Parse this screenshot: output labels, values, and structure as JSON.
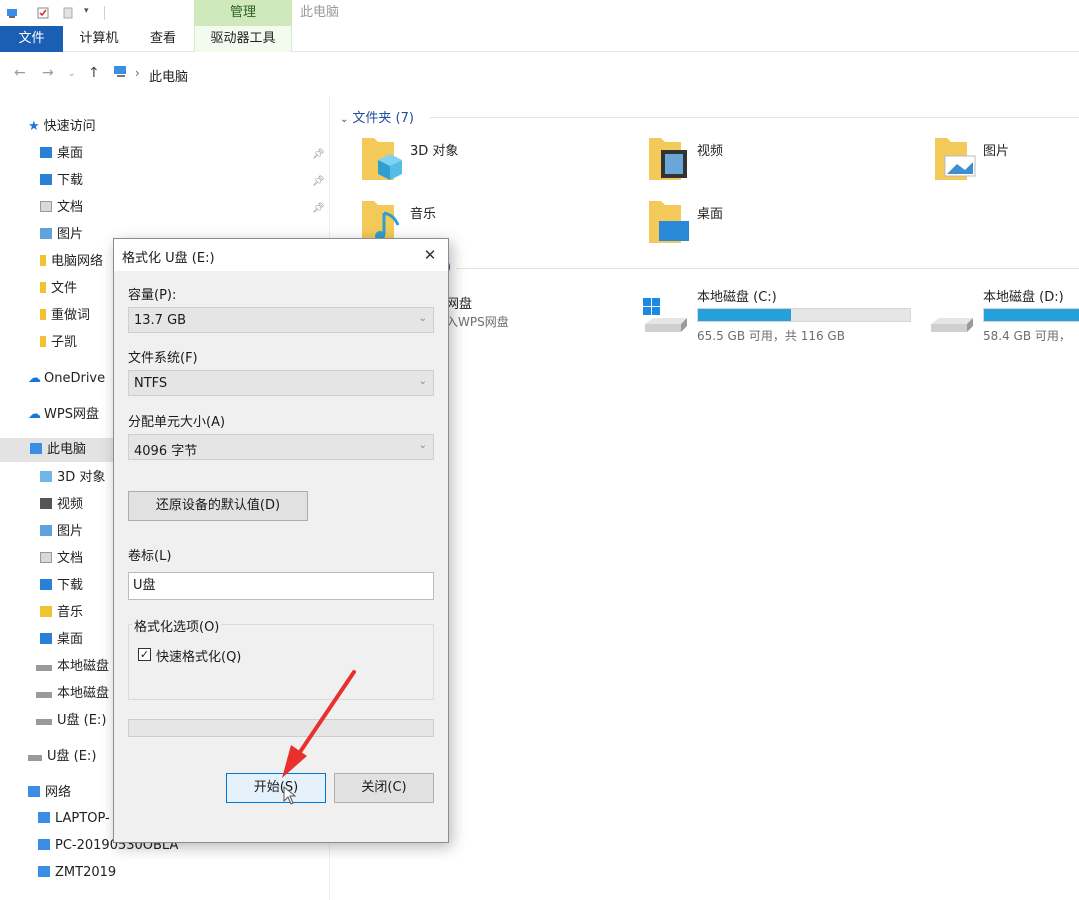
{
  "ribbon": {
    "context_tab": "管理",
    "window_title": "此电脑",
    "tabs": [
      "文件",
      "计算机",
      "查看",
      "驱动器工具"
    ]
  },
  "address": {
    "path": "此电脑"
  },
  "nav_pane": {
    "quick_access": "快速访问",
    "quick_items": [
      "桌面",
      "下载",
      "文档",
      "图片",
      "电脑网络",
      "文件",
      "重做词",
      "子凯"
    ],
    "onedrive": "OneDrive",
    "wps": "WPS网盘",
    "this_pc": "此电脑",
    "pc_items": [
      "3D 对象",
      "视频",
      "图片",
      "文档",
      "下载",
      "音乐",
      "桌面",
      "本地磁盘",
      "本地磁盘",
      "U盘 (E:)"
    ],
    "usb": "U盘 (E:)",
    "network": "网络",
    "network_items": [
      "LAPTOP-",
      "PC-20190530OBLA",
      "ZMT2019"
    ]
  },
  "content": {
    "folders_header": "文件夹 (7)",
    "folders": [
      "3D 对象",
      "视频",
      "图片",
      "音乐",
      "桌面"
    ],
    "devices_header_partial": ")",
    "wps_partial_name": "网盘",
    "wps_partial_info": "入WPS网盘",
    "drives": [
      {
        "name": "本地磁盘 (C:)",
        "info": "65.5 GB 可用，共 116 GB",
        "used_fraction": 0.44
      },
      {
        "name": "本地磁盘 (D:)",
        "info": "58.4 GB 可用，",
        "used_fraction": 0.55
      }
    ]
  },
  "dialog": {
    "title": "格式化 U盘 (E:)",
    "close": "✕",
    "capacity_label": "容量(P):",
    "capacity_value": "13.7 GB",
    "fs_label": "文件系统(F)",
    "fs_value": "NTFS",
    "alloc_label": "分配单元大小(A)",
    "alloc_value": "4096 字节",
    "restore_button": "还原设备的默认值(D)",
    "volume_label": "卷标(L)",
    "volume_value": "U盘",
    "options_label": "格式化选项(O)",
    "quick_format_label": "快速格式化(Q)",
    "quick_format_checked": "✓",
    "progress_fraction": 0,
    "start_button": "开始(S)",
    "close_button": "关闭(C)"
  },
  "colors": {
    "accent": "#1a5fb4",
    "context_tab": "#cfe9bd",
    "drive_fill": "#26a0da",
    "annotation_arrow": "#e8312f"
  }
}
